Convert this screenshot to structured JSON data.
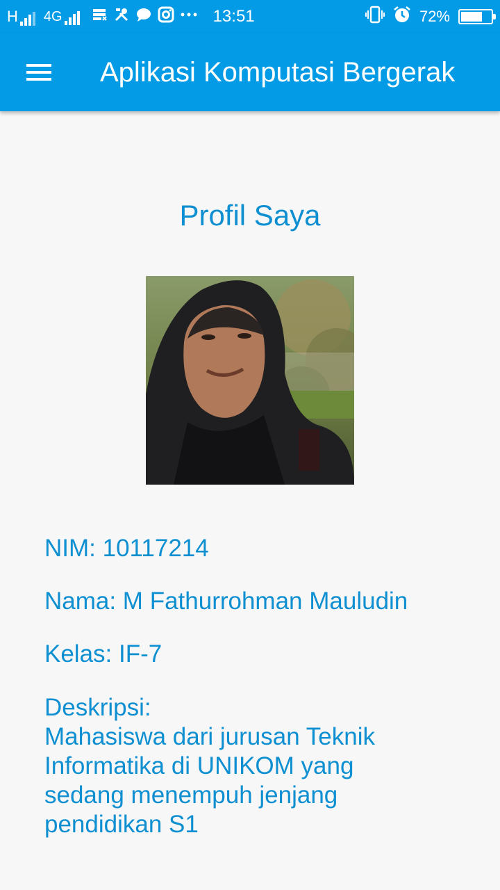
{
  "status_bar": {
    "network_h": "H",
    "network_4g": "4G",
    "time": "13:51",
    "battery_percent": "72%",
    "battery_level": 0.72,
    "icons": [
      "signal-icon",
      "signal-icon",
      "data-saver-icon",
      "tools-icon",
      "chat-icon",
      "instagram-icon",
      "more-icon",
      "vibrate-icon",
      "alarm-icon",
      "battery-icon"
    ]
  },
  "app_bar": {
    "title": "Aplikasi Komputasi Bergerak",
    "menu_icon": "menu-icon"
  },
  "profile": {
    "title": "Profil Saya",
    "nim": "NIM: 10117214",
    "nama": "Nama: M Fathurrohman Mauludin",
    "kelas": "Kelas: IF-7",
    "deskripsi_label": "Deskripsi:",
    "deskripsi_text": "Mahasiswa dari jurusan Teknik Informatika di UNIKOM yang sedang menempuh jenjang pendidikan S1"
  },
  "colors": {
    "primary": "#039be5",
    "text_accent": "#0d8fd1",
    "background": "#f7f7f7"
  }
}
